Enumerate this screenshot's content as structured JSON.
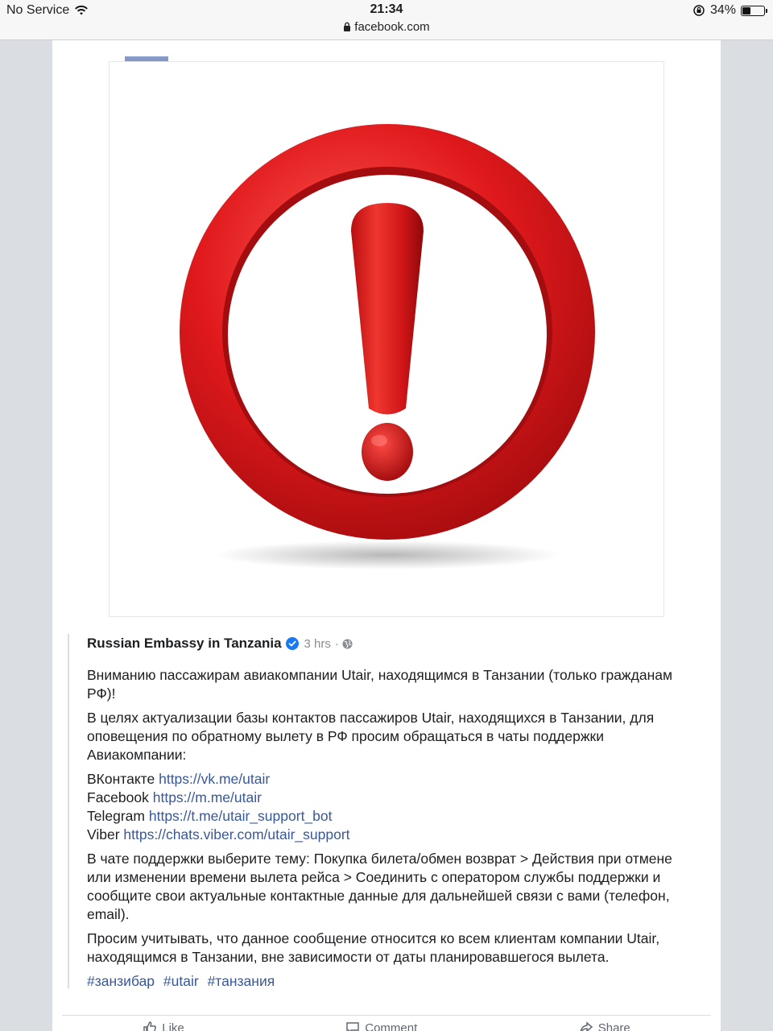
{
  "status_bar": {
    "carrier": "No Service",
    "time": "21:34",
    "url": "facebook.com",
    "battery_percent": "34%",
    "battery_level": 0.34
  },
  "post": {
    "image": {
      "icon": "exclamation-circle-icon",
      "accent_color": "#d7191c"
    },
    "shared": {
      "author": "Russian Embassy in Tanzania",
      "time": "3 hrs",
      "separator": "·",
      "paragraphs": [
        "Вниманию пассажирам авиакомпании Utair, находящимся в Танзании (только гражданам РФ)!",
        "В целях актуализации базы контактов пассажиров Utair, находящихся в Танзании, для оповещения по обратному вылету в РФ просим обращаться в чаты поддержки Авиакомпании:"
      ],
      "contacts": [
        {
          "label": "ВКонтакте",
          "url": "https://vk.me/utair"
        },
        {
          "label": "Facebook",
          "url": "https://m.me/utair"
        },
        {
          "label": "Telegram",
          "url": "https://t.me/utair_support_bot"
        },
        {
          "label": "Viber",
          "url": "https://chats.viber.com/utair_support"
        }
      ],
      "paragraphs_after": [
        "В чате поддержки выберите тему: Покупка билета/обмен возврат > Действия при отмене или изменении времени вылета рейса > Соединить с оператором службы поддержки и сообщите свои актуальные контактные данные для дальнейшей связи с вами (телефон, email).",
        "Просим учитывать, что данное сообщение относится ко всем клиентам компании Utair, находящимся в Танзании, вне зависимости от даты планировавшегося вылета."
      ],
      "hashtags": [
        "#занзибар",
        "#utair",
        "#танзания"
      ]
    },
    "actions": {
      "like": "Like",
      "comment": "Comment",
      "share": "Share"
    }
  }
}
